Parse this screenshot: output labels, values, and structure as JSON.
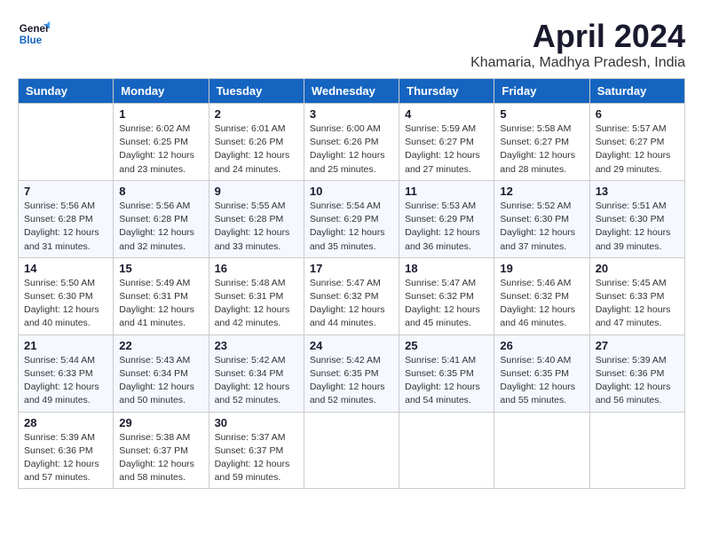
{
  "header": {
    "logo_line1": "General",
    "logo_line2": "Blue",
    "month_year": "April 2024",
    "location": "Khamaria, Madhya Pradesh, India"
  },
  "weekdays": [
    "Sunday",
    "Monday",
    "Tuesday",
    "Wednesday",
    "Thursday",
    "Friday",
    "Saturday"
  ],
  "weeks": [
    [
      {
        "day": "",
        "sunrise": "",
        "sunset": "",
        "daylight": ""
      },
      {
        "day": "1",
        "sunrise": "Sunrise: 6:02 AM",
        "sunset": "Sunset: 6:25 PM",
        "daylight": "Daylight: 12 hours and 23 minutes."
      },
      {
        "day": "2",
        "sunrise": "Sunrise: 6:01 AM",
        "sunset": "Sunset: 6:26 PM",
        "daylight": "Daylight: 12 hours and 24 minutes."
      },
      {
        "day": "3",
        "sunrise": "Sunrise: 6:00 AM",
        "sunset": "Sunset: 6:26 PM",
        "daylight": "Daylight: 12 hours and 25 minutes."
      },
      {
        "day": "4",
        "sunrise": "Sunrise: 5:59 AM",
        "sunset": "Sunset: 6:27 PM",
        "daylight": "Daylight: 12 hours and 27 minutes."
      },
      {
        "day": "5",
        "sunrise": "Sunrise: 5:58 AM",
        "sunset": "Sunset: 6:27 PM",
        "daylight": "Daylight: 12 hours and 28 minutes."
      },
      {
        "day": "6",
        "sunrise": "Sunrise: 5:57 AM",
        "sunset": "Sunset: 6:27 PM",
        "daylight": "Daylight: 12 hours and 29 minutes."
      }
    ],
    [
      {
        "day": "7",
        "sunrise": "Sunrise: 5:56 AM",
        "sunset": "Sunset: 6:28 PM",
        "daylight": "Daylight: 12 hours and 31 minutes."
      },
      {
        "day": "8",
        "sunrise": "Sunrise: 5:56 AM",
        "sunset": "Sunset: 6:28 PM",
        "daylight": "Daylight: 12 hours and 32 minutes."
      },
      {
        "day": "9",
        "sunrise": "Sunrise: 5:55 AM",
        "sunset": "Sunset: 6:28 PM",
        "daylight": "Daylight: 12 hours and 33 minutes."
      },
      {
        "day": "10",
        "sunrise": "Sunrise: 5:54 AM",
        "sunset": "Sunset: 6:29 PM",
        "daylight": "Daylight: 12 hours and 35 minutes."
      },
      {
        "day": "11",
        "sunrise": "Sunrise: 5:53 AM",
        "sunset": "Sunset: 6:29 PM",
        "daylight": "Daylight: 12 hours and 36 minutes."
      },
      {
        "day": "12",
        "sunrise": "Sunrise: 5:52 AM",
        "sunset": "Sunset: 6:30 PM",
        "daylight": "Daylight: 12 hours and 37 minutes."
      },
      {
        "day": "13",
        "sunrise": "Sunrise: 5:51 AM",
        "sunset": "Sunset: 6:30 PM",
        "daylight": "Daylight: 12 hours and 39 minutes."
      }
    ],
    [
      {
        "day": "14",
        "sunrise": "Sunrise: 5:50 AM",
        "sunset": "Sunset: 6:30 PM",
        "daylight": "Daylight: 12 hours and 40 minutes."
      },
      {
        "day": "15",
        "sunrise": "Sunrise: 5:49 AM",
        "sunset": "Sunset: 6:31 PM",
        "daylight": "Daylight: 12 hours and 41 minutes."
      },
      {
        "day": "16",
        "sunrise": "Sunrise: 5:48 AM",
        "sunset": "Sunset: 6:31 PM",
        "daylight": "Daylight: 12 hours and 42 minutes."
      },
      {
        "day": "17",
        "sunrise": "Sunrise: 5:47 AM",
        "sunset": "Sunset: 6:32 PM",
        "daylight": "Daylight: 12 hours and 44 minutes."
      },
      {
        "day": "18",
        "sunrise": "Sunrise: 5:47 AM",
        "sunset": "Sunset: 6:32 PM",
        "daylight": "Daylight: 12 hours and 45 minutes."
      },
      {
        "day": "19",
        "sunrise": "Sunrise: 5:46 AM",
        "sunset": "Sunset: 6:32 PM",
        "daylight": "Daylight: 12 hours and 46 minutes."
      },
      {
        "day": "20",
        "sunrise": "Sunrise: 5:45 AM",
        "sunset": "Sunset: 6:33 PM",
        "daylight": "Daylight: 12 hours and 47 minutes."
      }
    ],
    [
      {
        "day": "21",
        "sunrise": "Sunrise: 5:44 AM",
        "sunset": "Sunset: 6:33 PM",
        "daylight": "Daylight: 12 hours and 49 minutes."
      },
      {
        "day": "22",
        "sunrise": "Sunrise: 5:43 AM",
        "sunset": "Sunset: 6:34 PM",
        "daylight": "Daylight: 12 hours and 50 minutes."
      },
      {
        "day": "23",
        "sunrise": "Sunrise: 5:42 AM",
        "sunset": "Sunset: 6:34 PM",
        "daylight": "Daylight: 12 hours and 52 minutes."
      },
      {
        "day": "24",
        "sunrise": "Sunrise: 5:42 AM",
        "sunset": "Sunset: 6:35 PM",
        "daylight": "Daylight: 12 hours and 52 minutes."
      },
      {
        "day": "25",
        "sunrise": "Sunrise: 5:41 AM",
        "sunset": "Sunset: 6:35 PM",
        "daylight": "Daylight: 12 hours and 54 minutes."
      },
      {
        "day": "26",
        "sunrise": "Sunrise: 5:40 AM",
        "sunset": "Sunset: 6:35 PM",
        "daylight": "Daylight: 12 hours and 55 minutes."
      },
      {
        "day": "27",
        "sunrise": "Sunrise: 5:39 AM",
        "sunset": "Sunset: 6:36 PM",
        "daylight": "Daylight: 12 hours and 56 minutes."
      }
    ],
    [
      {
        "day": "28",
        "sunrise": "Sunrise: 5:39 AM",
        "sunset": "Sunset: 6:36 PM",
        "daylight": "Daylight: 12 hours and 57 minutes."
      },
      {
        "day": "29",
        "sunrise": "Sunrise: 5:38 AM",
        "sunset": "Sunset: 6:37 PM",
        "daylight": "Daylight: 12 hours and 58 minutes."
      },
      {
        "day": "30",
        "sunrise": "Sunrise: 5:37 AM",
        "sunset": "Sunset: 6:37 PM",
        "daylight": "Daylight: 12 hours and 59 minutes."
      },
      {
        "day": "",
        "sunrise": "",
        "sunset": "",
        "daylight": ""
      },
      {
        "day": "",
        "sunrise": "",
        "sunset": "",
        "daylight": ""
      },
      {
        "day": "",
        "sunrise": "",
        "sunset": "",
        "daylight": ""
      },
      {
        "day": "",
        "sunrise": "",
        "sunset": "",
        "daylight": ""
      }
    ]
  ]
}
